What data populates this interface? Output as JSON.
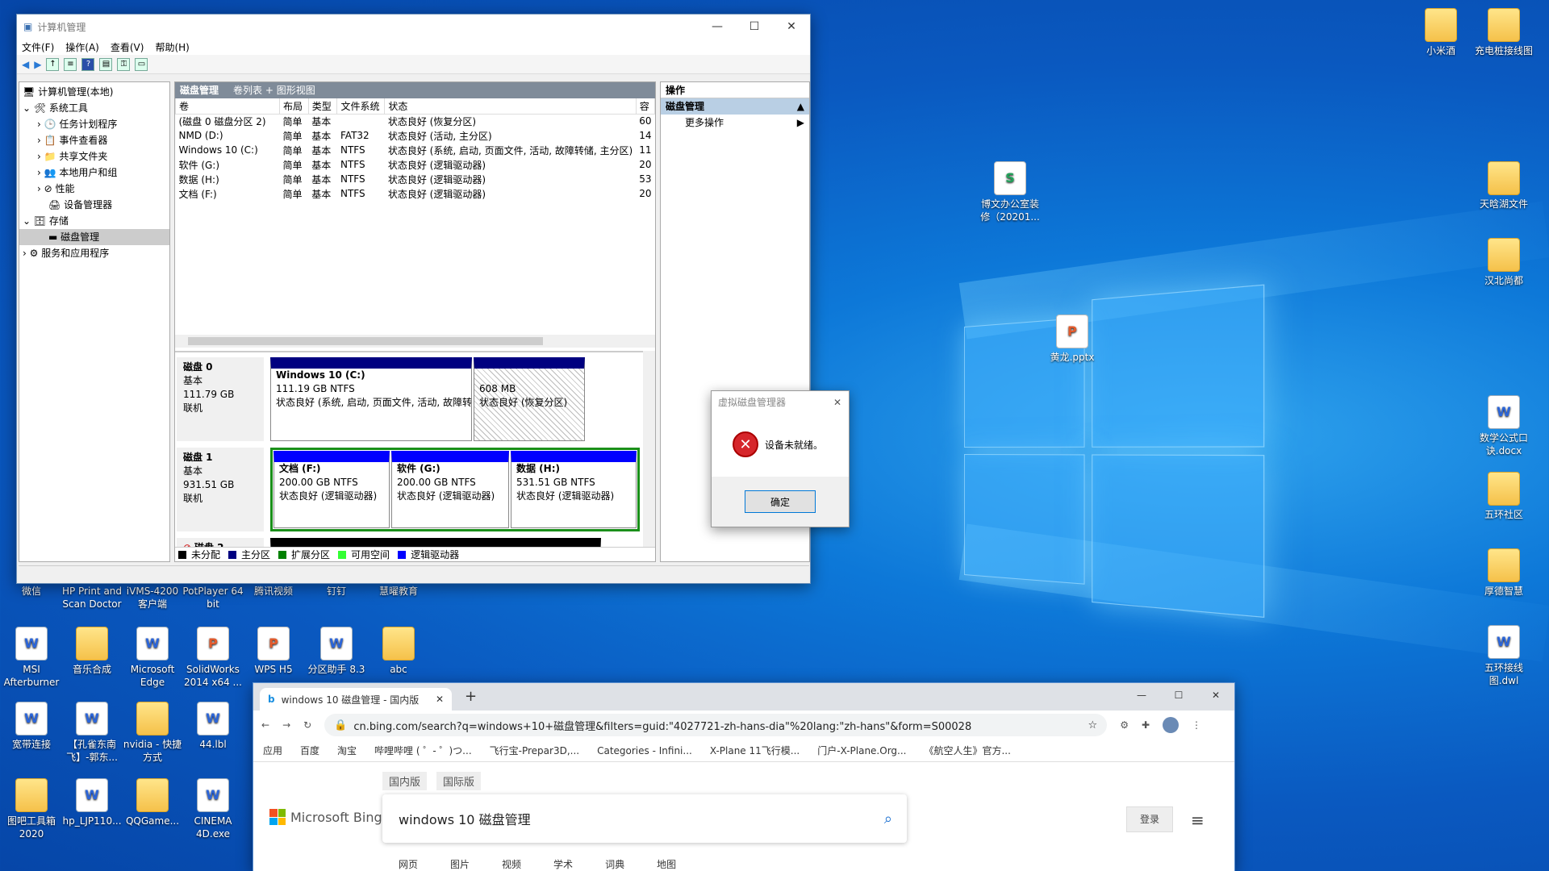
{
  "desktop_icons": [
    {
      "label": "微信",
      "x": 0,
      "y": 0
    },
    {
      "label": "HP Print and Scan Doctor"
    },
    {
      "label": "iVMS-4200 客户端"
    },
    {
      "label": "PotPlayer 64 bit"
    },
    {
      "label": "腾讯视频"
    },
    {
      "label": "钉钉"
    },
    {
      "label": "慧曜教育"
    },
    {
      "label": "MSI Afterburner"
    },
    {
      "label": "音乐合成"
    },
    {
      "label": "Microsoft Edge"
    },
    {
      "label": "SolidWorks 2014 x64 ..."
    },
    {
      "label": "WPS H5"
    },
    {
      "label": "分区助手 8.3"
    },
    {
      "label": "abc"
    },
    {
      "label": "宽带连接"
    },
    {
      "label": "【孔雀东南飞】-郭东..."
    },
    {
      "label": "nvidia - 快捷方式"
    },
    {
      "label": "44.lbl"
    },
    {
      "label": "图吧工具箱2020"
    },
    {
      "label": "hp_LJP110..."
    },
    {
      "label": "QQGame..."
    },
    {
      "label": "CINEMA 4D.exe"
    },
    {
      "label": "小米酒"
    },
    {
      "label": "充电桩接线图"
    },
    {
      "label": "博文办公室装修（20201..."
    },
    {
      "label": "天晗湖文件"
    },
    {
      "label": "汉北尚都"
    },
    {
      "label": "黄龙.pptx"
    },
    {
      "label": "数学公式口诀.docx"
    },
    {
      "label": "五环社区"
    },
    {
      "label": "厚德智慧"
    },
    {
      "label": "五环接线图.dwl"
    }
  ],
  "cm": {
    "title": "计算机管理",
    "menu": [
      "文件(F)",
      "操作(A)",
      "查看(V)",
      "帮助(H)"
    ],
    "tree": [
      {
        "label": "计算机管理(本地)"
      },
      {
        "label": "系统工具"
      },
      {
        "label": "任务计划程序"
      },
      {
        "label": "事件查看器"
      },
      {
        "label": "共享文件夹"
      },
      {
        "label": "本地用户和组"
      },
      {
        "label": "性能"
      },
      {
        "label": "设备管理器"
      },
      {
        "label": "存储"
      },
      {
        "label": "磁盘管理"
      },
      {
        "label": "服务和应用程序"
      }
    ],
    "panel_title": "磁盘管理",
    "panel_sub": "卷列表 + 图形视图",
    "columns": [
      "卷",
      "布局",
      "类型",
      "文件系统",
      "状态",
      "容"
    ],
    "volumes": [
      [
        "(磁盘 0 磁盘分区 2)",
        "简单",
        "基本",
        "",
        "状态良好 (恢复分区)",
        "60"
      ],
      [
        "NMD (D:)",
        "简单",
        "基本",
        "FAT32",
        "状态良好 (活动, 主分区)",
        "14"
      ],
      [
        "Windows 10 (C:)",
        "简单",
        "基本",
        "NTFS",
        "状态良好 (系统, 启动, 页面文件, 活动, 故障转储, 主分区)",
        "11"
      ],
      [
        "软件 (G:)",
        "简单",
        "基本",
        "NTFS",
        "状态良好 (逻辑驱动器)",
        "20"
      ],
      [
        "数据 (H:)",
        "简单",
        "基本",
        "NTFS",
        "状态良好 (逻辑驱动器)",
        "53"
      ],
      [
        "文档 (F:)",
        "简单",
        "基本",
        "NTFS",
        "状态良好 (逻辑驱动器)",
        "20"
      ]
    ],
    "disk0": {
      "name": "磁盘 0",
      "type": "基本",
      "size": "111.79 GB",
      "state": "联机",
      "p1_name": "Windows 10  (C:)",
      "p1_size": "111.19 GB NTFS",
      "p1_status": "状态良好 (系统, 启动, 页面文件, 活动, 故障转",
      "p2_size": "608 MB",
      "p2_status": "状态良好 (恢复分区)"
    },
    "disk1": {
      "name": "磁盘 1",
      "type": "基本",
      "size": "931.51 GB",
      "state": "联机",
      "f_name": "文档  (F:)",
      "f_size": "200.00 GB NTFS",
      "f_status": "状态良好 (逻辑驱动器)",
      "g_name": "软件  (G:)",
      "g_size": "200.00 GB NTFS",
      "g_status": "状态良好 (逻辑驱动器)",
      "h_name": "数据  (H:)",
      "h_size": "531.51 GB NTFS",
      "h_status": "状态良好 (逻辑驱动器)"
    },
    "disk2": {
      "name": "磁盘 2"
    },
    "legend": [
      "未分配",
      "主分区",
      "扩展分区",
      "可用空间",
      "逻辑驱动器"
    ],
    "legend_colors": [
      "#000000",
      "#000080",
      "#008000",
      "#33ff33",
      "#0000ff"
    ],
    "actions_title": "操作",
    "actions_section": "磁盘管理",
    "actions_more": "更多操作"
  },
  "dialog": {
    "title": "虚拟磁盘管理器",
    "message": "设备未就绪。",
    "ok": "确定"
  },
  "chrome": {
    "tab_title": "windows 10 磁盘管理 - 国内版",
    "url": "cn.bing.com/search?q=windows+10+磁盘管理&filters=guid:\"4027721-zh-hans-dia\"%20lang:\"zh-hans\"&form=S00028",
    "bookmarks": [
      "应用",
      "百度",
      "淘宝",
      "哔哩哔哩 ( ゜- ゜)つ...",
      "飞行宝-Prepar3D,...",
      "Categories - Infini...",
      "X-Plane 11飞行模...",
      "门户-X-Plane.Org...",
      "《航空人生》官方..."
    ],
    "scope": [
      "国内版",
      "国际版"
    ],
    "brand": "Microsoft Bing",
    "query": "windows 10 磁盘管理",
    "login": "登录",
    "nav": [
      "网页",
      "图片",
      "视频",
      "学术",
      "词典",
      "地图"
    ]
  }
}
